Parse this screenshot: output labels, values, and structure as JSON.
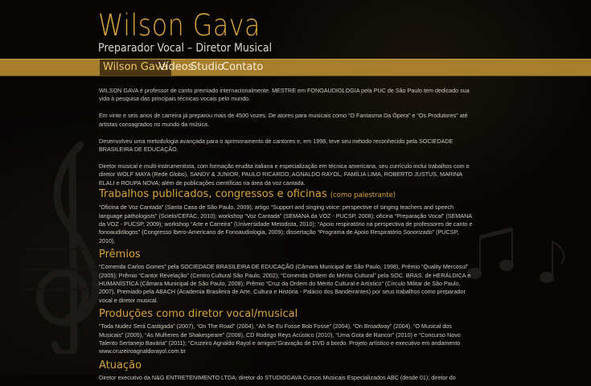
{
  "header": {
    "title": "Wilson Gava",
    "subtitle": "Preparador Vocal – Diretor Musical"
  },
  "nav": {
    "items": [
      {
        "label": "Wilson Gava",
        "active": true
      },
      {
        "label": "Vídeos",
        "active": false
      },
      {
        "label": "Studio",
        "active": false
      },
      {
        "label": "Contato",
        "active": false
      }
    ]
  },
  "colors": {
    "accent": "#d7a23c",
    "nav_bar": "#a77e2b",
    "background": "#070605",
    "text": "#cfc9bd"
  },
  "intro": [
    "WILSON GAVA é professor de canto premiado internacionalmente. MESTRE em FONOAUDIOLOGIA pela PUC de São Paulo tem dedicado sua vida à pesquisa das principais técnicas vocais pelo mundo.",
    "Em vinte e seis anos de carreira já preparou mais de 4500 vozes. De atores para musicais como “O Fantasma Da Ópera” e “Os Produtores” até artistas consagrados no mundo da música.",
    "Desenvolveu uma metodologia avançada para o aprimoramento de cantores e, em 1998, teve seu método reconhecido pela SOCIEDADE BRASILEIRA DE EDUCAÇÃO.",
    "Diretor musical e multi-instrumentista, com formação erudita italiana e especialização em técnica americana, seu currículo inclui trabalhos com o diretor WOLF MAYA (Rede Globo), SANDY & JUNIOR, PAULO RICARDO, AGNALDO RAYOL, FAMÍLIA LIMA, ROBERTO JUSTUS, MARINA ELALI e ROUPA NOVA; além de publicações científicas na área da voz cantada."
  ],
  "sections": [
    {
      "title": "Trabalhos publicados, congressos e oficinas",
      "note": "(como palestrante)",
      "body": "“Oficina de Voz Cantada” (Santa Casa de São Paulo, 2009); artigo “Support and singing voice: perspective of singing teachers and speech language pathologists” (Scielo/CEFAC, 2010); workshop “Voz Cantada” (SEMANA da VOZ - PUCSP, 2008); oficina “Preparação Vocal” (SEMANA da VOZ - PUCSP, 2009); workshop “Arte e Carreira” (Universidade Metodista, 2010); “Apoio respiratório na perspectiva de professores de canto e fonoaudiólogos” (Congresso Ibero-Americano de Fonoaudiologia, 2009); dissertação “Programa de Apoio Respiratório Sonorizado” (PUCSP, 2010)."
    },
    {
      "title": "Prêmios",
      "note": "",
      "body": "“Comenda Carlos Gomes” pela SOCIEDADE BRASILEIRA DE EDUCAÇÃO (Câmara Municipal de São Paulo, 1998), Prêmio “Quality Mercosul” (2005); Prêmio “Cantor Revelação” (Centro Cultural São Paulo, 2002); “Comenda Ordem do Mérito Cultural” pela SOC. BRAS. de HERÁLDICA e HUMANÍSTICA (Câmara Municipal de São Paulo, 2008); Prêmio “Cruz da Ordem do Mérito Cultural e Artístico” (Círculo Militar de São Paulo, 2007), Premiado pela ABACH (Academia Brasileira de Arte, Cultura e História - Palácio dos Bandeirantes) por seus trabalhos como preparador vocal e diretor musical."
    },
    {
      "title": "Produções como diretor vocal/musical",
      "note": "",
      "body": "“Toda Nudez Será Castigada” (2007), “On The Road” (2004), “Ah Se Eu Fosse Bob Fosse” (2004), “On Broadway” (2004), “O Musical dos Musicais” (2005), “As Mulheres de Shakespeare” (2008), CD Rodrigo Reys Acústico (2010), “Uma Gota de Rancor” (2010) e “Concurso Novo Talento Sertanejo Bavária” (2011); “Cruzeiro Agnaldo Rayol e amigos”Gravação de DVD a bordo. Projeto artístico e executivo em andamento www.cruzeiroagnaldorayol.com.br"
    },
    {
      "title": "Atuação",
      "note": "",
      "body": "Diretor executivo da N&G ENTRETENIMENTO LTDA; diretor do STUDIOGAVA Cursos Musicais Especializados ABC (desde 01); diretor do"
    }
  ]
}
